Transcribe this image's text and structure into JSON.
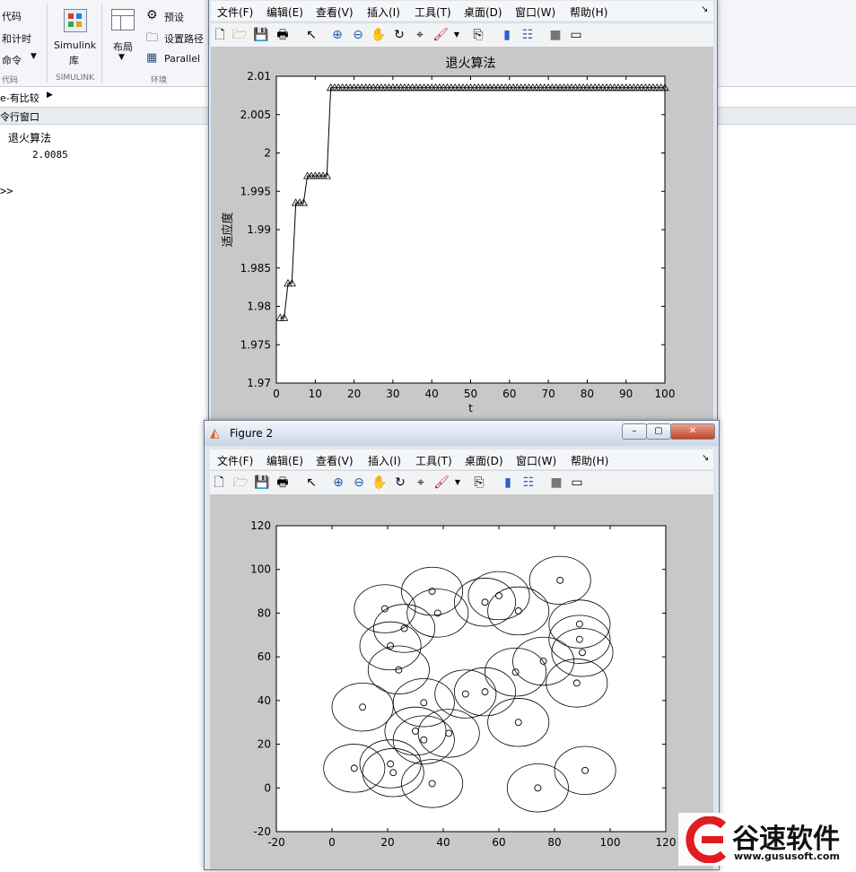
{
  "ribbon": {
    "left_items": [
      "代码",
      "和计时",
      "命令"
    ],
    "simulink_label": "Simulink",
    "simulink_sub": "库",
    "layout_label": "布局",
    "preset_label": "预设",
    "setpath_label": "设置路径",
    "parallel_label": "Parallel",
    "section_code": "代码",
    "section_simulink": "SIMULINK",
    "section_env": "环境"
  },
  "address": {
    "path": "e-有比较"
  },
  "command_window": {
    "header": "令行窗口",
    "line1": "退火算法",
    "line2": "2.0085",
    "prompt": ">>"
  },
  "figure1": {
    "menu": [
      "文件(F)",
      "编辑(E)",
      "查看(V)",
      "插入(I)",
      "工具(T)",
      "桌面(D)",
      "窗口(W)",
      "帮助(H)"
    ],
    "dock_glyph": "↘"
  },
  "figure2": {
    "title": "Figure 2",
    "menu": [
      "文件(F)",
      "编辑(E)",
      "查看(V)",
      "插入(I)",
      "工具(T)",
      "桌面(D)",
      "窗口(W)",
      "帮助(H)"
    ],
    "dock_glyph": "↘"
  },
  "watermark": {
    "name": "谷速软件",
    "url": "www.gususoft.com"
  },
  "chart_data": [
    {
      "type": "line",
      "title": "退火算法",
      "xlabel": "t",
      "ylabel": "适应度",
      "xlim": [
        0,
        100
      ],
      "ylim": [
        1.97,
        2.01
      ],
      "xticks": [
        0,
        10,
        20,
        30,
        40,
        50,
        60,
        70,
        80,
        90,
        100
      ],
      "yticks": [
        1.97,
        1.975,
        1.98,
        1.985,
        1.99,
        1.995,
        2,
        2.005,
        2.01
      ],
      "ytick_labels": [
        "1.97",
        "1.975",
        "1.98",
        "1.985",
        "1.99",
        "1.995",
        "2",
        "2.005",
        "2.01"
      ],
      "marker": "triangle",
      "x": [
        1,
        2,
        3,
        4,
        5,
        6,
        7,
        8,
        9,
        10,
        11,
        12,
        13,
        14
      ],
      "y": [
        1.9785,
        1.9785,
        1.983,
        1.983,
        1.9935,
        1.9935,
        1.9935,
        1.997,
        1.997,
        1.997,
        1.997,
        1.997,
        1.997,
        2.0085
      ],
      "plateau_from": 14,
      "plateau_to": 100,
      "plateau_value": 2.0085
    },
    {
      "type": "scatter",
      "xlim": [
        -20,
        120
      ],
      "ylim": [
        -20,
        120
      ],
      "xticks": [
        -20,
        0,
        20,
        40,
        60,
        80,
        100,
        120
      ],
      "yticks": [
        -20,
        0,
        20,
        40,
        60,
        80,
        100,
        120
      ],
      "circle_radius": 11,
      "points": [
        [
          8,
          9
        ],
        [
          21,
          11
        ],
        [
          22,
          7
        ],
        [
          36,
          2
        ],
        [
          11,
          37
        ],
        [
          30,
          26
        ],
        [
          33,
          22
        ],
        [
          42,
          25
        ],
        [
          33,
          39
        ],
        [
          24,
          54
        ],
        [
          21,
          65
        ],
        [
          26,
          73
        ],
        [
          19,
          82
        ],
        [
          36,
          90
        ],
        [
          38,
          80
        ],
        [
          48,
          43
        ],
        [
          55,
          44
        ],
        [
          55,
          85
        ],
        [
          60,
          88
        ],
        [
          67,
          81
        ],
        [
          82,
          95
        ],
        [
          66,
          53
        ],
        [
          76,
          58
        ],
        [
          67,
          30
        ],
        [
          74,
          0
        ],
        [
          91,
          8
        ],
        [
          88,
          48
        ],
        [
          89,
          68
        ],
        [
          90,
          62
        ],
        [
          89,
          75
        ]
      ]
    }
  ]
}
